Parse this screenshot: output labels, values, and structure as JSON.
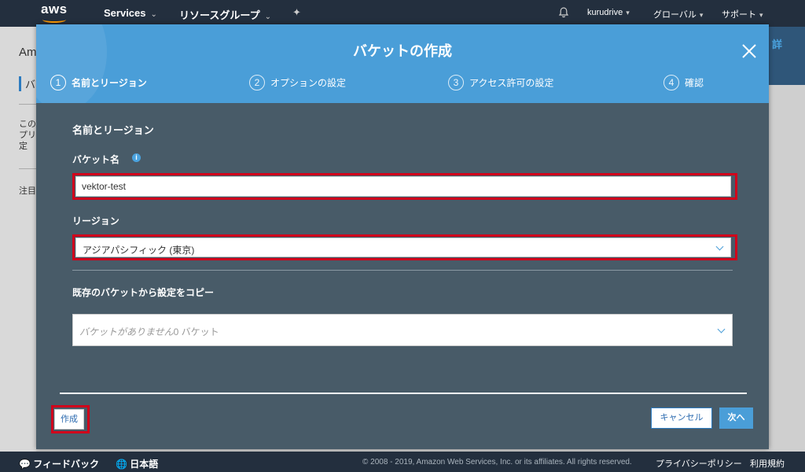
{
  "topnav": {
    "logo": "aws",
    "services": "Services",
    "resource_groups": "リソースグループ",
    "user": "kurudrive",
    "region": "グローバル",
    "support": "サポート"
  },
  "background_page": {
    "title_fragment": "Am",
    "tab_fragment": "バ",
    "desc_fragment": "このプリ定",
    "note_fragment": "注目",
    "right_fragment": "詳"
  },
  "modal": {
    "title": "バケットの作成",
    "steps": [
      {
        "num": "1",
        "label": "名前とリージョン",
        "active": true
      },
      {
        "num": "2",
        "label": "オプションの設定",
        "active": false
      },
      {
        "num": "3",
        "label": "アクセス許可の設定",
        "active": false
      },
      {
        "num": "4",
        "label": "確認",
        "active": false
      }
    ],
    "section_title": "名前とリージョン",
    "bucket_name_label": "バケット名",
    "bucket_name_value": "vektor-test",
    "region_label": "リージョン",
    "region_value": "アジアパシフィック (東京)",
    "copy_label": "既存のバケットから設定をコピー",
    "copy_placeholder": "バケットがありません",
    "copy_count": "0 バケット",
    "create_button": "作成",
    "cancel_button": "キャンセル",
    "next_button": "次へ"
  },
  "bottombar": {
    "feedback": "フィードバック",
    "language": "日本語",
    "copyright": "© 2008 - 2019, Amazon Web Services, Inc. or its affiliates. All rights reserved.",
    "privacy": "プライバシーポリシー",
    "terms": "利用規約"
  },
  "colors": {
    "nav_bg": "#232f3e",
    "modal_header": "#4a9ed8",
    "modal_body": "#485b68",
    "highlight": "#d0021b"
  }
}
